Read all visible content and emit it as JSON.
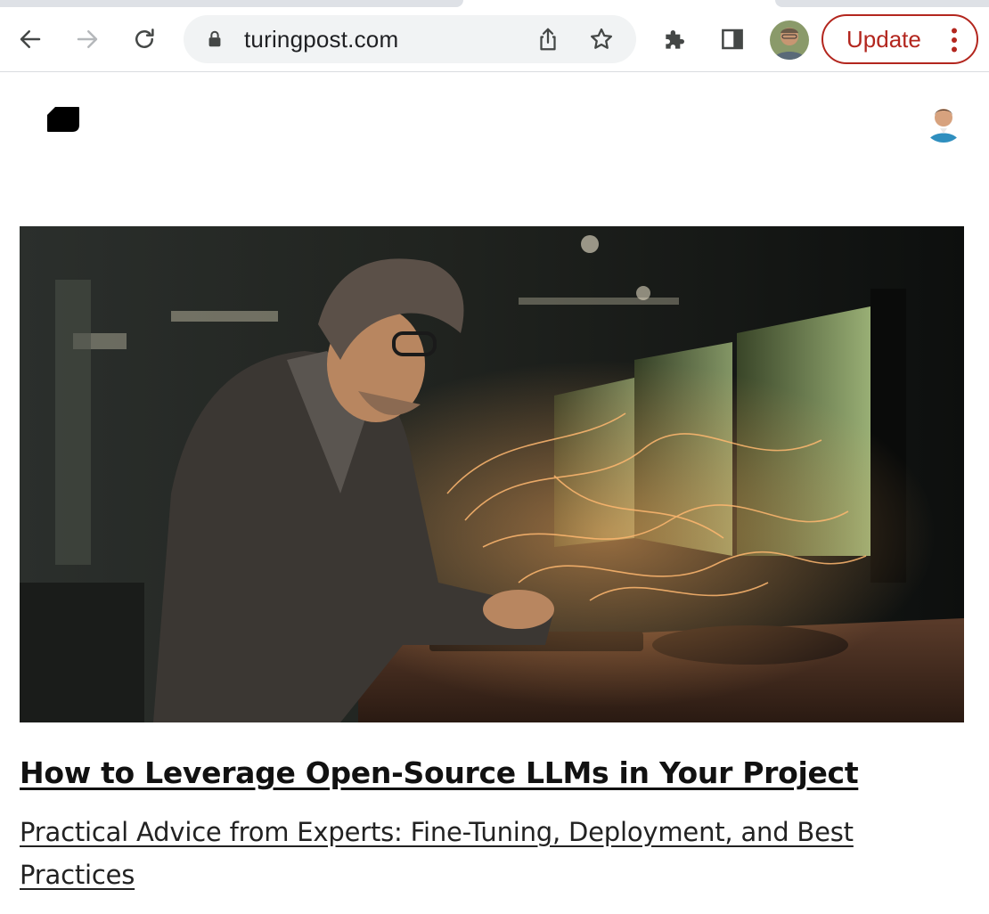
{
  "browser": {
    "omnibox": {
      "url": "turingpost.com"
    },
    "update_button": {
      "label": "Update"
    },
    "icons": {
      "back": "arrow-left-icon",
      "forward": "arrow-right-icon",
      "reload": "reload-icon",
      "lock": "lock-icon",
      "share": "share-icon",
      "bookmark": "star-icon",
      "extensions": "puzzle-icon",
      "side_panel": "side-panel-icon",
      "menu": "three-dots-vertical-icon"
    },
    "colors": {
      "update_accent": "#b3261e",
      "omnibox_bg": "#f1f3f4"
    }
  },
  "page": {
    "post": {
      "title": "How to Leverage Open-Source LLMs in Your Project",
      "subtitle": "Practical Advice from Experts: Fine-Tuning, Deployment, and Best Practices"
    }
  }
}
